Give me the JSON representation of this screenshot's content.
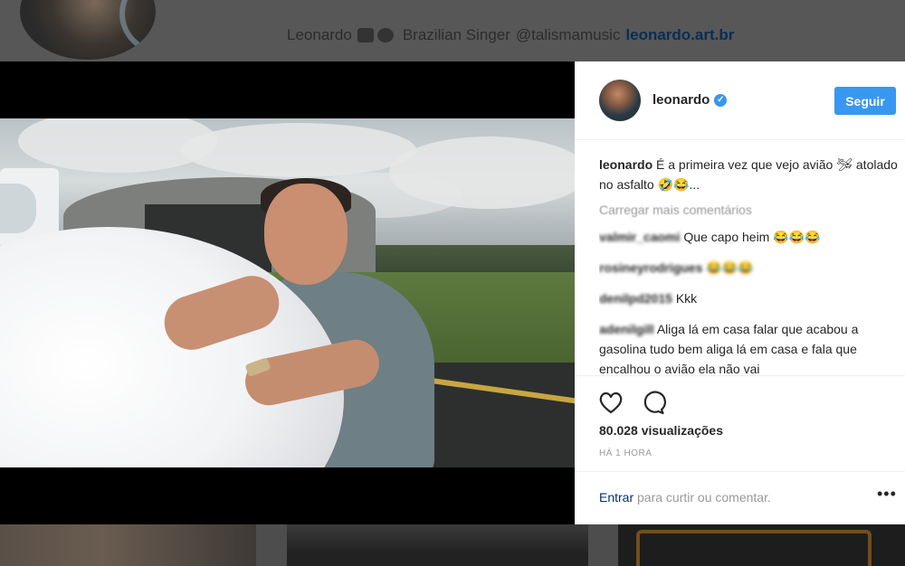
{
  "background_profile": {
    "bio_name": "Leonardo",
    "bio_text": "Brazilian Singer",
    "bio_mention": "@talismamusic",
    "bio_link": "leonardo.art.br"
  },
  "post": {
    "header": {
      "username": "leonardo",
      "verified": true,
      "follow_label": "Seguir"
    },
    "caption": {
      "username": "leonardo",
      "text": "É a primeira vez que vejo avião 🛩 atolado no asfalto 🤣😂..."
    },
    "load_more_label": "Carregar mais comentários",
    "comments": [
      {
        "username": "valmir_caomi",
        "text": "Que capo heim 😂😂😂"
      },
      {
        "username": "rosineyrodrigues",
        "text": "😂😂😂"
      },
      {
        "username": "denilpd2015",
        "text": "Kkk"
      },
      {
        "username": "adenilgill",
        "text": "Aliga lá em casa falar que acabou a gasolina tudo bem aliga lá em casa e fala que encalhou o avião ela não vai"
      }
    ],
    "views": "80.028 visualizações",
    "time_ago": "HÁ 1 HORA",
    "login_link": "Entrar",
    "login_suffix": " para curtir ou comentar.",
    "more_label": "•••"
  },
  "icons": {
    "like": "heart-outline-icon",
    "comment": "speech-bubble-icon",
    "verified": "verified-badge-icon"
  },
  "colors": {
    "accent": "#3897f0",
    "link": "#003569",
    "muted": "#999999"
  }
}
